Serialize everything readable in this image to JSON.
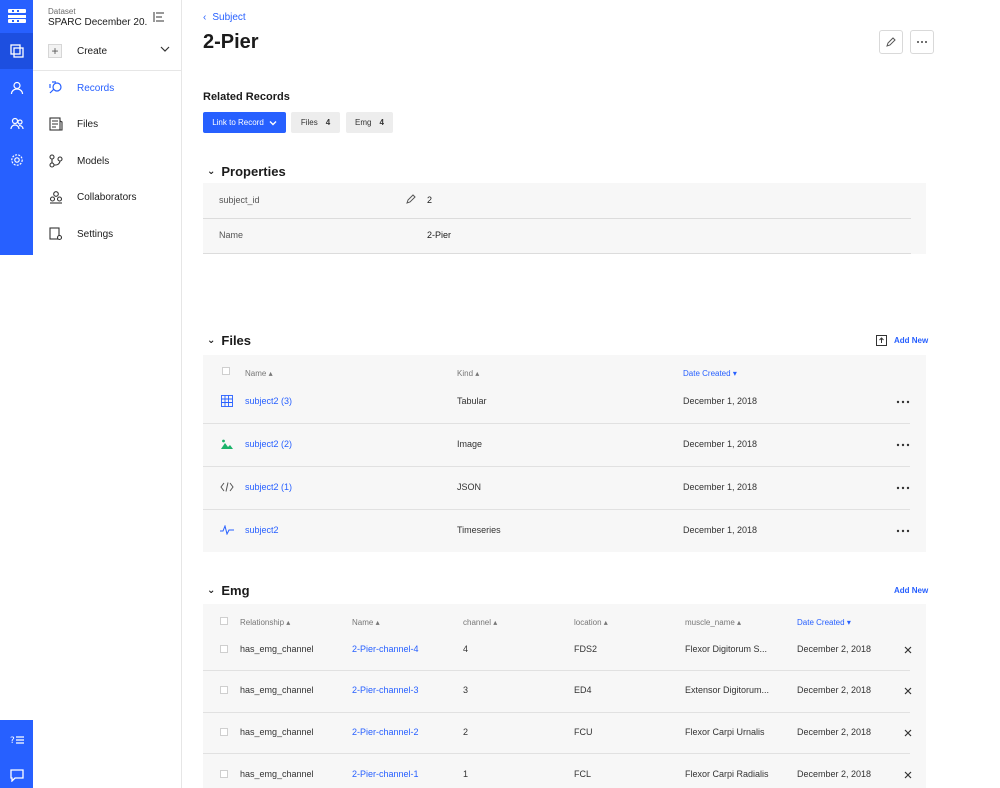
{
  "sidebar": {
    "dataset_label": "Dataset",
    "dataset_name": "SPARC December 20...",
    "create_label": "Create",
    "items": [
      {
        "label": "Records",
        "icon": "records-icon",
        "active": true
      },
      {
        "label": "Files",
        "icon": "files-icon",
        "active": false
      },
      {
        "label": "Models",
        "icon": "models-icon",
        "active": false
      },
      {
        "label": "Collaborators",
        "icon": "collaborators-icon",
        "active": false
      },
      {
        "label": "Settings",
        "icon": "settings-icon",
        "active": false
      }
    ]
  },
  "header": {
    "back_label": "Subject",
    "title": "2-Pier"
  },
  "related": {
    "title": "Related Records",
    "link_button": "Link to Record",
    "chips": [
      {
        "label": "Files",
        "count": "4"
      },
      {
        "label": "Emg",
        "count": "4"
      }
    ]
  },
  "properties": {
    "title": "Properties",
    "rows": [
      {
        "key": "subject_id",
        "value": "2"
      },
      {
        "key": "Name",
        "value": "2-Pier"
      }
    ]
  },
  "files": {
    "title": "Files",
    "add_new": "Add New",
    "columns": {
      "name": "Name",
      "kind": "Kind",
      "date": "Date Created"
    },
    "rows": [
      {
        "name": "subject2 (3)",
        "kind": "Tabular",
        "date": "December 1, 2018",
        "icon": "table-icon"
      },
      {
        "name": "subject2 (2)",
        "kind": "Image",
        "date": "December 1, 2018",
        "icon": "image-icon"
      },
      {
        "name": "subject2 (1)",
        "kind": "JSON",
        "date": "December 1, 2018",
        "icon": "code-icon"
      },
      {
        "name": "subject2",
        "kind": "Timeseries",
        "date": "December 1, 2018",
        "icon": "timeseries-icon"
      }
    ]
  },
  "emg": {
    "title": "Emg",
    "add_new": "Add New",
    "columns": {
      "relationship": "Relationship",
      "name": "Name",
      "channel": "channel",
      "location": "location",
      "muscle": "muscle_name",
      "date": "Date Created"
    },
    "rows": [
      {
        "relationship": "has_emg_channel",
        "name": "2-Pier-channel-4",
        "channel": "4",
        "location": "FDS2",
        "muscle": "Flexor Digitorum S...",
        "date": "December 2, 2018"
      },
      {
        "relationship": "has_emg_channel",
        "name": "2-Pier-channel-3",
        "channel": "3",
        "location": "ED4",
        "muscle": "Extensor Digitorum...",
        "date": "December 2, 2018"
      },
      {
        "relationship": "has_emg_channel",
        "name": "2-Pier-channel-2",
        "channel": "2",
        "location": "FCU",
        "muscle": "Flexor Carpi Urnalis",
        "date": "December 2, 2018"
      },
      {
        "relationship": "has_emg_channel",
        "name": "2-Pier-channel-1",
        "channel": "1",
        "location": "FCL",
        "muscle": "Flexor Carpi Radialis",
        "date": "December 2, 2018"
      }
    ]
  },
  "colors": {
    "accent": "#2760ff",
    "rail": "#2760ff"
  }
}
